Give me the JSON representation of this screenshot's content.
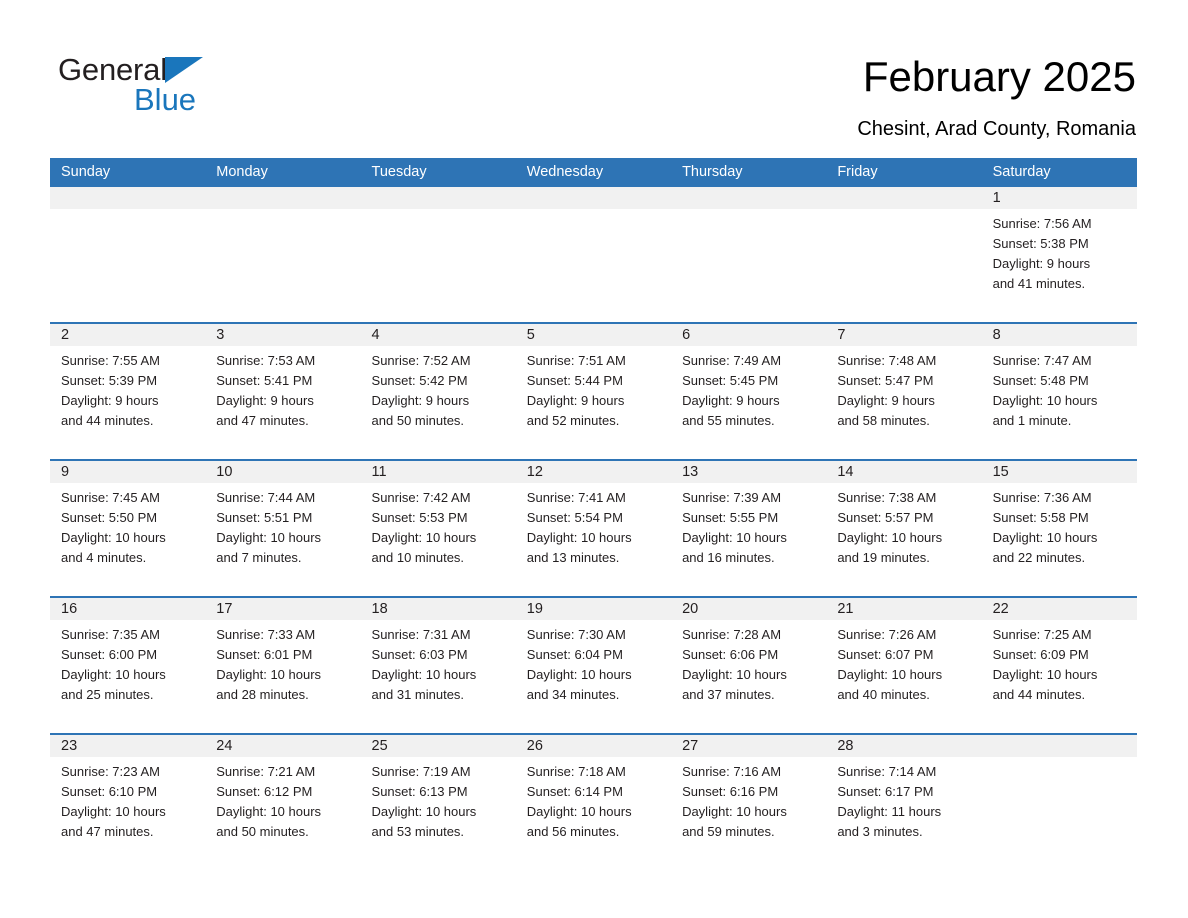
{
  "logo": {
    "word1": "General",
    "word2": "Blue",
    "triangle_color": "#1a76bc"
  },
  "header": {
    "title": "February 2025",
    "subtitle": "Chesint, Arad County, Romania",
    "accent_color": "#2e74b5",
    "daynum_band_color": "#f1f1f1"
  },
  "weekdays": [
    "Sunday",
    "Monday",
    "Tuesday",
    "Wednesday",
    "Thursday",
    "Friday",
    "Saturday"
  ],
  "weeks": [
    [
      {
        "day": "",
        "sunrise": "",
        "sunset": "",
        "daylight1": "",
        "daylight2": ""
      },
      {
        "day": "",
        "sunrise": "",
        "sunset": "",
        "daylight1": "",
        "daylight2": ""
      },
      {
        "day": "",
        "sunrise": "",
        "sunset": "",
        "daylight1": "",
        "daylight2": ""
      },
      {
        "day": "",
        "sunrise": "",
        "sunset": "",
        "daylight1": "",
        "daylight2": ""
      },
      {
        "day": "",
        "sunrise": "",
        "sunset": "",
        "daylight1": "",
        "daylight2": ""
      },
      {
        "day": "",
        "sunrise": "",
        "sunset": "",
        "daylight1": "",
        "daylight2": ""
      },
      {
        "day": "1",
        "sunrise": "Sunrise: 7:56 AM",
        "sunset": "Sunset: 5:38 PM",
        "daylight1": "Daylight: 9 hours",
        "daylight2": "and 41 minutes."
      }
    ],
    [
      {
        "day": "2",
        "sunrise": "Sunrise: 7:55 AM",
        "sunset": "Sunset: 5:39 PM",
        "daylight1": "Daylight: 9 hours",
        "daylight2": "and 44 minutes."
      },
      {
        "day": "3",
        "sunrise": "Sunrise: 7:53 AM",
        "sunset": "Sunset: 5:41 PM",
        "daylight1": "Daylight: 9 hours",
        "daylight2": "and 47 minutes."
      },
      {
        "day": "4",
        "sunrise": "Sunrise: 7:52 AM",
        "sunset": "Sunset: 5:42 PM",
        "daylight1": "Daylight: 9 hours",
        "daylight2": "and 50 minutes."
      },
      {
        "day": "5",
        "sunrise": "Sunrise: 7:51 AM",
        "sunset": "Sunset: 5:44 PM",
        "daylight1": "Daylight: 9 hours",
        "daylight2": "and 52 minutes."
      },
      {
        "day": "6",
        "sunrise": "Sunrise: 7:49 AM",
        "sunset": "Sunset: 5:45 PM",
        "daylight1": "Daylight: 9 hours",
        "daylight2": "and 55 minutes."
      },
      {
        "day": "7",
        "sunrise": "Sunrise: 7:48 AM",
        "sunset": "Sunset: 5:47 PM",
        "daylight1": "Daylight: 9 hours",
        "daylight2": "and 58 minutes."
      },
      {
        "day": "8",
        "sunrise": "Sunrise: 7:47 AM",
        "sunset": "Sunset: 5:48 PM",
        "daylight1": "Daylight: 10 hours",
        "daylight2": "and 1 minute."
      }
    ],
    [
      {
        "day": "9",
        "sunrise": "Sunrise: 7:45 AM",
        "sunset": "Sunset: 5:50 PM",
        "daylight1": "Daylight: 10 hours",
        "daylight2": "and 4 minutes."
      },
      {
        "day": "10",
        "sunrise": "Sunrise: 7:44 AM",
        "sunset": "Sunset: 5:51 PM",
        "daylight1": "Daylight: 10 hours",
        "daylight2": "and 7 minutes."
      },
      {
        "day": "11",
        "sunrise": "Sunrise: 7:42 AM",
        "sunset": "Sunset: 5:53 PM",
        "daylight1": "Daylight: 10 hours",
        "daylight2": "and 10 minutes."
      },
      {
        "day": "12",
        "sunrise": "Sunrise: 7:41 AM",
        "sunset": "Sunset: 5:54 PM",
        "daylight1": "Daylight: 10 hours",
        "daylight2": "and 13 minutes."
      },
      {
        "day": "13",
        "sunrise": "Sunrise: 7:39 AM",
        "sunset": "Sunset: 5:55 PM",
        "daylight1": "Daylight: 10 hours",
        "daylight2": "and 16 minutes."
      },
      {
        "day": "14",
        "sunrise": "Sunrise: 7:38 AM",
        "sunset": "Sunset: 5:57 PM",
        "daylight1": "Daylight: 10 hours",
        "daylight2": "and 19 minutes."
      },
      {
        "day": "15",
        "sunrise": "Sunrise: 7:36 AM",
        "sunset": "Sunset: 5:58 PM",
        "daylight1": "Daylight: 10 hours",
        "daylight2": "and 22 minutes."
      }
    ],
    [
      {
        "day": "16",
        "sunrise": "Sunrise: 7:35 AM",
        "sunset": "Sunset: 6:00 PM",
        "daylight1": "Daylight: 10 hours",
        "daylight2": "and 25 minutes."
      },
      {
        "day": "17",
        "sunrise": "Sunrise: 7:33 AM",
        "sunset": "Sunset: 6:01 PM",
        "daylight1": "Daylight: 10 hours",
        "daylight2": "and 28 minutes."
      },
      {
        "day": "18",
        "sunrise": "Sunrise: 7:31 AM",
        "sunset": "Sunset: 6:03 PM",
        "daylight1": "Daylight: 10 hours",
        "daylight2": "and 31 minutes."
      },
      {
        "day": "19",
        "sunrise": "Sunrise: 7:30 AM",
        "sunset": "Sunset: 6:04 PM",
        "daylight1": "Daylight: 10 hours",
        "daylight2": "and 34 minutes."
      },
      {
        "day": "20",
        "sunrise": "Sunrise: 7:28 AM",
        "sunset": "Sunset: 6:06 PM",
        "daylight1": "Daylight: 10 hours",
        "daylight2": "and 37 minutes."
      },
      {
        "day": "21",
        "sunrise": "Sunrise: 7:26 AM",
        "sunset": "Sunset: 6:07 PM",
        "daylight1": "Daylight: 10 hours",
        "daylight2": "and 40 minutes."
      },
      {
        "day": "22",
        "sunrise": "Sunrise: 7:25 AM",
        "sunset": "Sunset: 6:09 PM",
        "daylight1": "Daylight: 10 hours",
        "daylight2": "and 44 minutes."
      }
    ],
    [
      {
        "day": "23",
        "sunrise": "Sunrise: 7:23 AM",
        "sunset": "Sunset: 6:10 PM",
        "daylight1": "Daylight: 10 hours",
        "daylight2": "and 47 minutes."
      },
      {
        "day": "24",
        "sunrise": "Sunrise: 7:21 AM",
        "sunset": "Sunset: 6:12 PM",
        "daylight1": "Daylight: 10 hours",
        "daylight2": "and 50 minutes."
      },
      {
        "day": "25",
        "sunrise": "Sunrise: 7:19 AM",
        "sunset": "Sunset: 6:13 PM",
        "daylight1": "Daylight: 10 hours",
        "daylight2": "and 53 minutes."
      },
      {
        "day": "26",
        "sunrise": "Sunrise: 7:18 AM",
        "sunset": "Sunset: 6:14 PM",
        "daylight1": "Daylight: 10 hours",
        "daylight2": "and 56 minutes."
      },
      {
        "day": "27",
        "sunrise": "Sunrise: 7:16 AM",
        "sunset": "Sunset: 6:16 PM",
        "daylight1": "Daylight: 10 hours",
        "daylight2": "and 59 minutes."
      },
      {
        "day": "28",
        "sunrise": "Sunrise: 7:14 AM",
        "sunset": "Sunset: 6:17 PM",
        "daylight1": "Daylight: 11 hours",
        "daylight2": "and 3 minutes."
      },
      {
        "day": "",
        "sunrise": "",
        "sunset": "",
        "daylight1": "",
        "daylight2": ""
      }
    ]
  ]
}
